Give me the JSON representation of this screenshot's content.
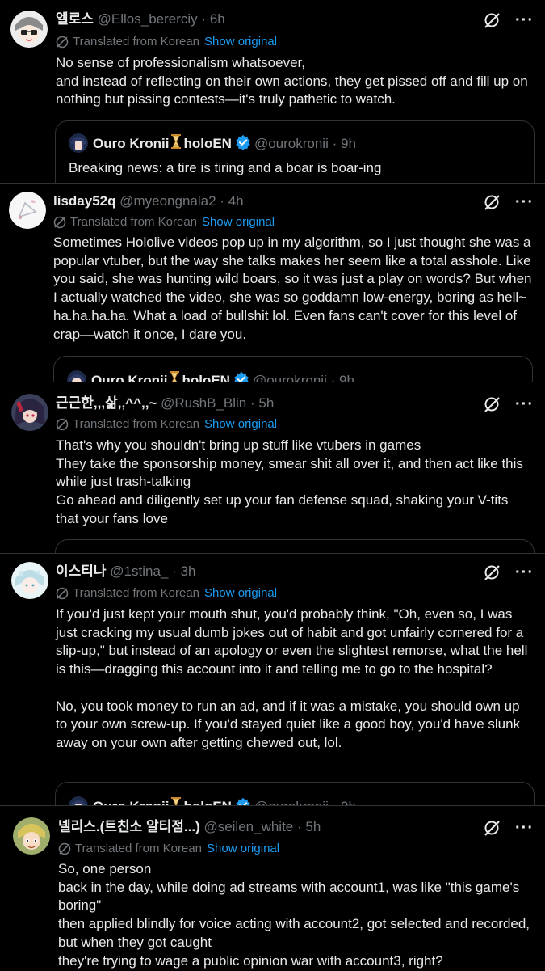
{
  "ui": {
    "translated_label": "Translated from Korean",
    "show_original": "Show original",
    "more": "···",
    "dot": "·"
  },
  "quoted": {
    "name": "Ouro Kronii",
    "suffix": "holoEN",
    "handle": "@ourokronii",
    "time": "9h",
    "text": "Breaking news: a tire is tiring and a boar is boar-ing"
  },
  "posts": [
    {
      "name": "엘로스",
      "handle": "@Ellos_bererciy",
      "time": "6h",
      "paragraphs": [
        "No sense of professionalism whatsoever,",
        "and instead of reflecting on their own actions, they get pissed off and fill up on nothing but pissing contests—it's truly pathetic to watch."
      ]
    },
    {
      "name": "lisday52q",
      "handle": "@myeongnala2",
      "time": "4h",
      "paragraphs": [
        "Sometimes Hololive videos pop up in my algorithm, so I just thought she was a popular vtuber, but the way she talks makes her seem like a total asshole. Like you said, she was hunting wild boars, so it was just a play on words? But when I actually watched the video, she was so goddamn low-energy, boring as hell~ ha.ha.ha.ha. What a load of bullshit lol. Even fans can't cover for this level of crap—watch it once, I dare you."
      ]
    },
    {
      "name": "근근한,,,삶,,^^,,~",
      "handle": "@RushB_Blin",
      "time": "5h",
      "paragraphs": [
        "That's why you shouldn't bring up stuff like vtubers in games",
        "They take the sponsorship money, smear shit all over it, and then act like this while just trash-talking",
        "Go ahead and diligently set up your fan defense squad, shaking your V-tits that your fans love"
      ]
    },
    {
      "name": "이스티나",
      "handle": "@1stina_",
      "time": "3h",
      "paragraphs": [
        "If you'd just kept your mouth shut, you'd probably think, \"Oh, even so, I was just cracking my usual dumb jokes out of habit and got unfairly cornered for a slip-up,\" but instead of an apology or even the slightest remorse, what the hell is this—dragging this account into it and telling me to go to the hospital?",
        "",
        "No, you took money to run an ad, and if it was a mistake, you should own up to your own screw-up. If you'd stayed quiet like a good boy, you'd have slunk away on your own after getting chewed out, lol."
      ]
    },
    {
      "name": "넬리스.(트친소 알티점...)",
      "handle": "@seilen_white",
      "time": "5h",
      "paragraphs": [
        "So, one person",
        "back in the day, while doing ad streams with account1, was like \"this game's boring\"",
        "then applied blindly for voice acting with account2, got selected and recorded, but when they got caught",
        "they're trying to wage a public opinion war with account3, right?"
      ]
    }
  ]
}
